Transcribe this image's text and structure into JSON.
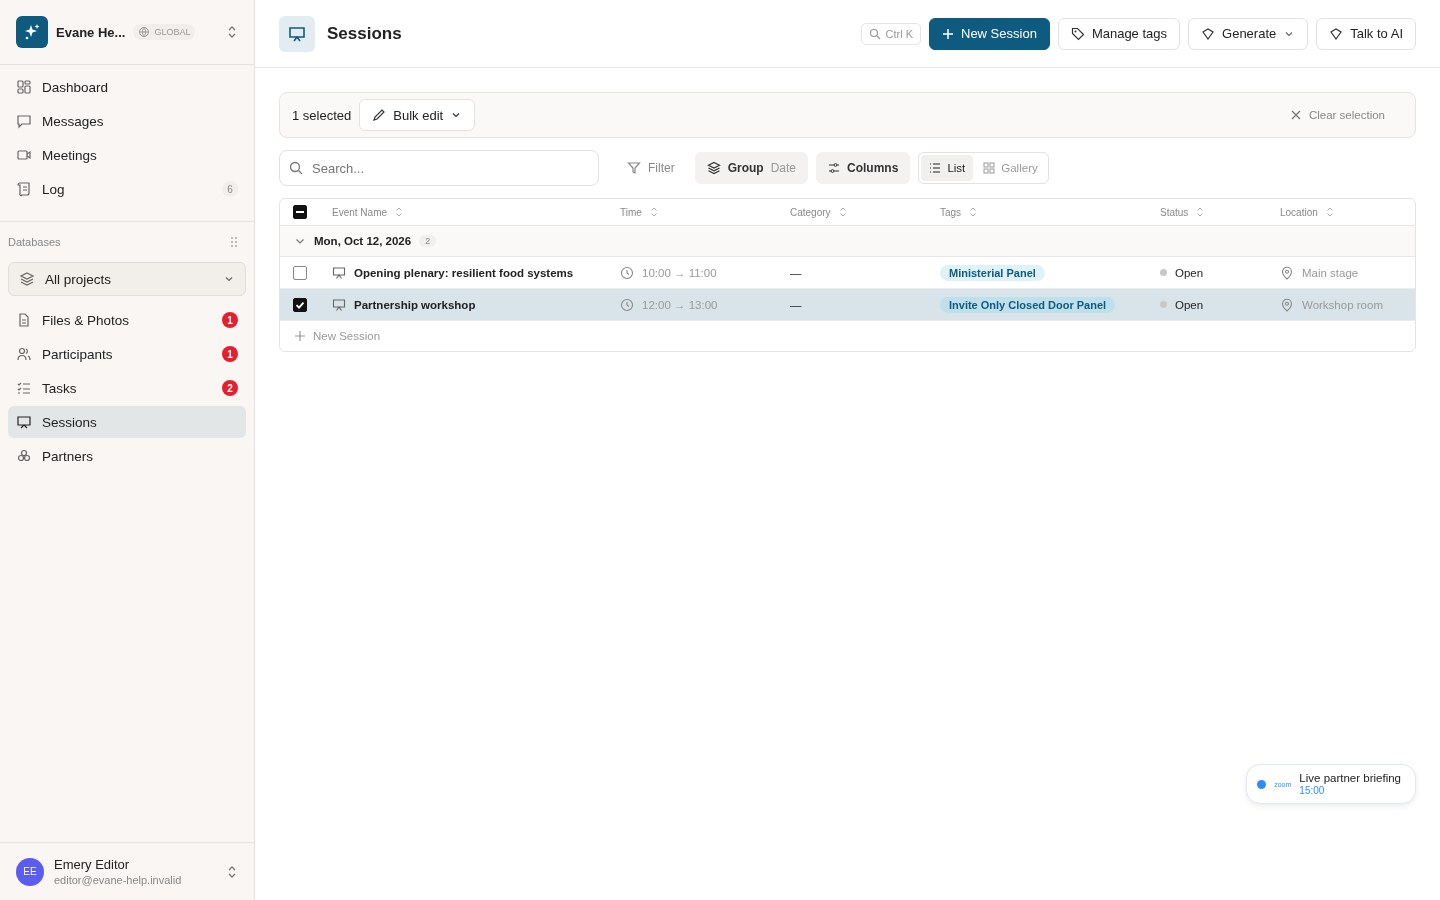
{
  "workspace": {
    "name": "Evane He...",
    "scope": "GLOBAL"
  },
  "nav": [
    {
      "label": "Dashboard",
      "selected": false
    },
    {
      "label": "Messages",
      "selected": false
    },
    {
      "label": "Meetings",
      "selected": false
    },
    {
      "label": "Log",
      "selected": false,
      "count": "6",
      "alert": false
    }
  ],
  "databases": {
    "title": "Databases",
    "project": "All projects",
    "items": [
      {
        "label": "Files & Photos",
        "selected": false,
        "count": "1",
        "alert": true
      },
      {
        "label": "Participants",
        "selected": false,
        "count": "1",
        "alert": true
      },
      {
        "label": "Tasks",
        "selected": false,
        "count": "2",
        "alert": true
      },
      {
        "label": "Sessions",
        "selected": true
      },
      {
        "label": "Partners",
        "selected": false
      }
    ]
  },
  "user": {
    "initials": "EE",
    "name": "Emery Editor",
    "email": "editor@evane-help.invalid"
  },
  "page_title": "Sessions",
  "header": {
    "search_hint": "Ctrl K",
    "new_button": "New Session",
    "manage_tags": "Manage tags",
    "generate": "Generate",
    "talk": "Talk to AI"
  },
  "selection": {
    "count_text": "1 selected",
    "bulk_edit": "Bulk edit",
    "clear": "Clear selection"
  },
  "toolbar": {
    "search": {
      "placeholder": "Search..."
    },
    "filter": "Filter",
    "group": "Group",
    "group_value": "Date",
    "columns": "Columns",
    "views": [
      {
        "label": "List",
        "selected": true
      },
      {
        "label": "Gallery",
        "selected": false
      }
    ]
  },
  "table": {
    "select_all": {
      "indeterminate": true
    },
    "columns": [
      "Event Name",
      "Time",
      "Category",
      "Tags",
      "Status",
      "Location"
    ],
    "group": {
      "label": "Mon, Oct 12, 2026",
      "count": "2",
      "expanded": true
    },
    "rows": [
      {
        "selected": false,
        "name": "Opening plenary: resilient food systems",
        "time": "10:00 → 11:00",
        "category": "—",
        "tag": "Ministerial Panel",
        "status": "Open",
        "location": "Main stage"
      },
      {
        "selected": true,
        "name": "Partnership workshop",
        "time": "12:00 → 13:00",
        "category": "—",
        "tag": "Invite Only Closed Door Panel",
        "status": "Open",
        "location": "Workshop room"
      }
    ],
    "add_row": "New Session"
  },
  "notification": {
    "brand": "zoom",
    "title": "Live partner briefing",
    "time": "15:00"
  }
}
